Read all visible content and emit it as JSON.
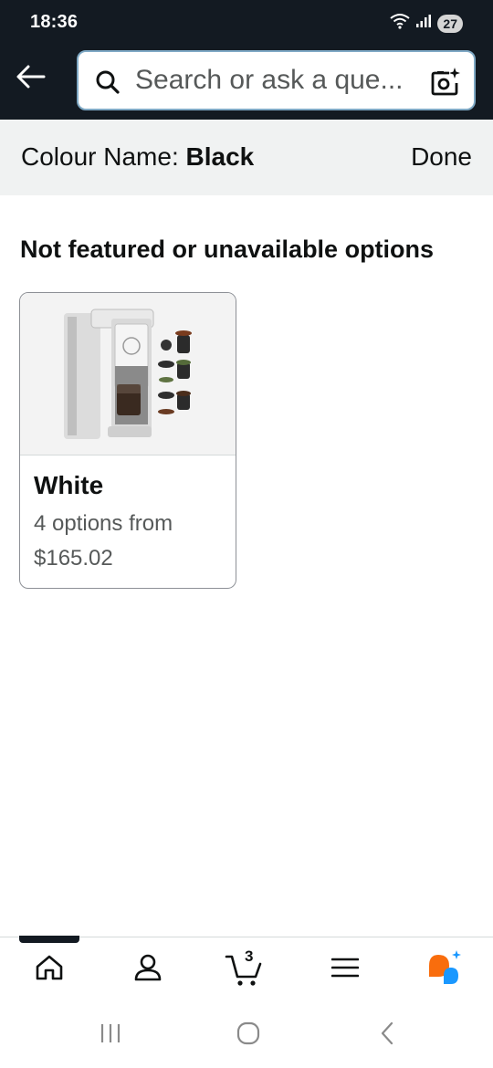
{
  "status_bar": {
    "time": "18:36",
    "battery": "27",
    "icons": [
      "wifi-icon",
      "signal-icon",
      "battery-icon"
    ]
  },
  "header": {
    "back_icon": "arrow-left-icon",
    "search": {
      "placeholder": "Search or ask a que...",
      "search_icon": "search-icon",
      "camera_icon": "camera-sparkle-icon"
    }
  },
  "colour_bar": {
    "label": "Colour Name: ",
    "value": "Black",
    "done_label": "Done"
  },
  "section": {
    "title": "Not featured or unavailable options"
  },
  "options": [
    {
      "name": "White",
      "options_text": "4 options from",
      "price": "$165.02",
      "image": "coffee-maker-image"
    }
  ],
  "bottom_nav": {
    "items": [
      "home-icon",
      "account-icon",
      "cart-icon",
      "menu-icon",
      "rufus-icon"
    ],
    "cart_count": "3"
  },
  "system_nav": {
    "items": [
      "recent-apps-icon",
      "home-circle-icon",
      "back-chevron-icon"
    ]
  },
  "colors": {
    "header_bg": "#131a22",
    "search_border": "#7fa9c5",
    "colour_bar_bg": "#f0f2f2",
    "rufus_orange": "#f96d0d",
    "rufus_blue": "#1a98ff"
  }
}
